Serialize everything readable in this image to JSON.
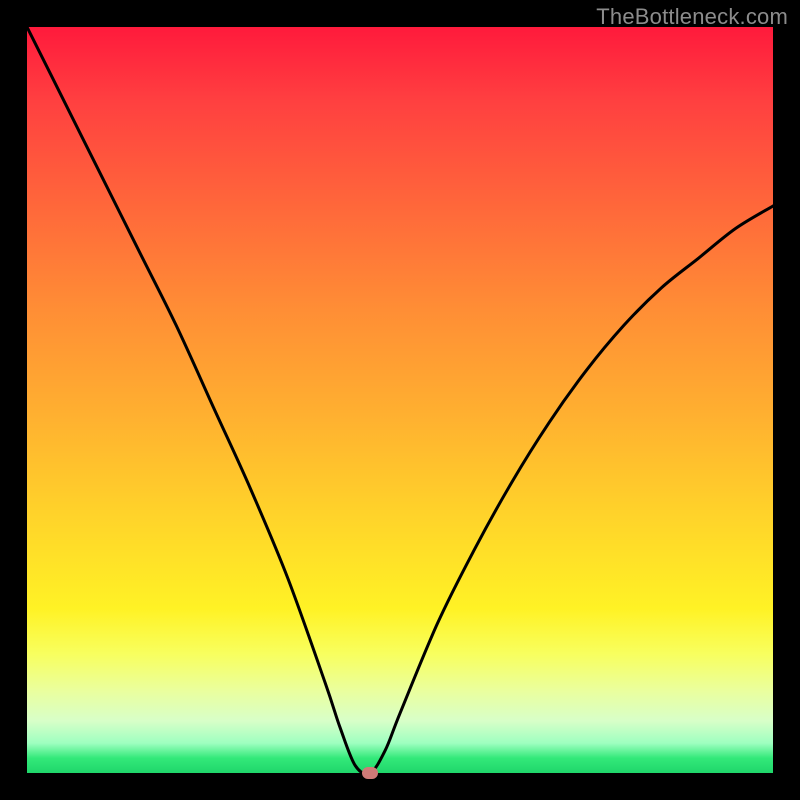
{
  "watermark": "TheBottleneck.com",
  "colors": {
    "frame": "#000000",
    "curve": "#000000",
    "marker": "#cf7a77",
    "gradient_top": "#ff1a3c",
    "gradient_bottom": "#1fd66a"
  },
  "chart_data": {
    "type": "line",
    "title": "",
    "xlabel": "",
    "ylabel": "",
    "xlim": [
      0,
      100
    ],
    "ylim": [
      0,
      100
    ],
    "x": [
      0,
      5,
      10,
      15,
      20,
      25,
      30,
      35,
      40,
      42,
      44,
      46,
      48,
      50,
      55,
      60,
      65,
      70,
      75,
      80,
      85,
      90,
      95,
      100
    ],
    "values": [
      100,
      90,
      80,
      70,
      60,
      49,
      38,
      26,
      12,
      6,
      1,
      0,
      3,
      8,
      20,
      30,
      39,
      47,
      54,
      60,
      65,
      69,
      73,
      76
    ],
    "marker": {
      "x": 46,
      "y": 0
    },
    "annotations": []
  }
}
